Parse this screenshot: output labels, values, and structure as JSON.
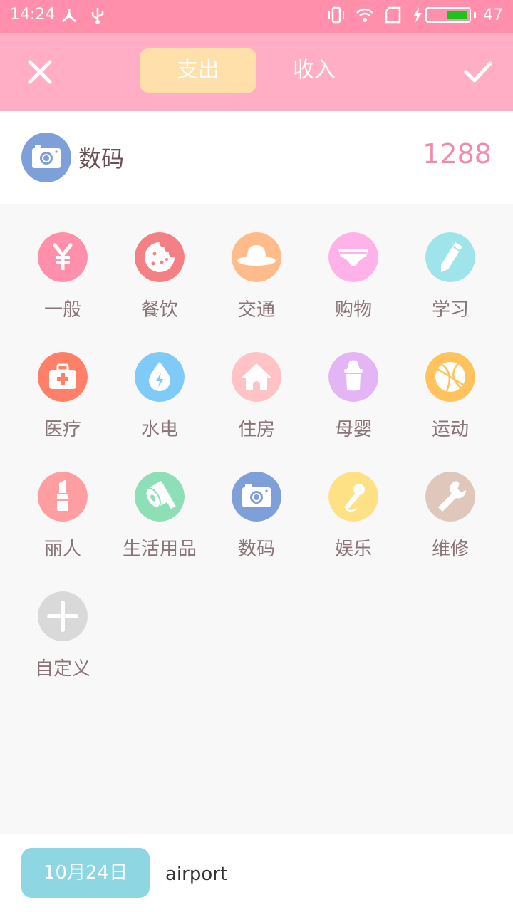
{
  "status_bar": {
    "time": "14:24",
    "battery_level": "47",
    "battery_fill": 0.47
  },
  "header": {
    "tab_expense": "支出",
    "tab_income": "收入",
    "close_icon": "close-icon",
    "confirm_icon": "check-icon"
  },
  "selected": {
    "label": "数码",
    "amount": "1288",
    "color": "#7f9fd9",
    "icon": "camera-icon"
  },
  "categories": [
    {
      "label": "一般",
      "color": "#ff8fab",
      "icon": "yen-icon"
    },
    {
      "label": "餐饮",
      "color": "#f47f84",
      "icon": "cookie-icon"
    },
    {
      "label": "交通",
      "color": "#ffbb8a",
      "icon": "hat-icon"
    },
    {
      "label": "购物",
      "color": "#ffb2ea",
      "icon": "underwear-icon"
    },
    {
      "label": "学习",
      "color": "#9fe4ea",
      "icon": "pencil-icon"
    },
    {
      "label": "医疗",
      "color": "#ff7f69",
      "icon": "first-aid-icon"
    },
    {
      "label": "水电",
      "color": "#7fcaf6",
      "icon": "water-electric-icon"
    },
    {
      "label": "住房",
      "color": "#ffc3c5",
      "icon": "house-icon"
    },
    {
      "label": "母婴",
      "color": "#e3b5f4",
      "icon": "baby-bottle-icon"
    },
    {
      "label": "运动",
      "color": "#ffc35e",
      "icon": "basketball-icon"
    },
    {
      "label": "丽人",
      "color": "#ff9ea0",
      "icon": "lipstick-icon"
    },
    {
      "label": "生活用品",
      "color": "#8edfb8",
      "icon": "toilet-paper-icon"
    },
    {
      "label": "数码",
      "color": "#7f9fd9",
      "icon": "camera-icon"
    },
    {
      "label": "娱乐",
      "color": "#ffe185",
      "icon": "microphone-icon"
    },
    {
      "label": "维修",
      "color": "#e0c7bc",
      "icon": "wrench-icon"
    },
    {
      "label": "自定义",
      "color": "#d9d9d9",
      "icon": "plus-icon"
    }
  ],
  "bottom": {
    "date": "10月24日",
    "note_value": "airport",
    "date_color": "#8dd6e2"
  }
}
